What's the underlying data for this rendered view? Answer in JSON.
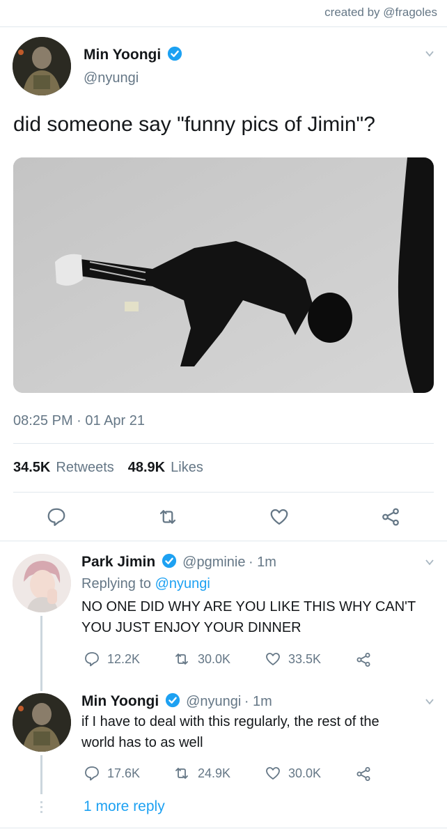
{
  "credit": "created by @fragoles",
  "main_tweet": {
    "name": "Min Yoongi",
    "handle": "@nyungi",
    "text": "did someone say \"funny pics of Jimin\"?",
    "timestamp": "08:25 PM · 01 Apr 21",
    "retweets_count": "34.5K",
    "retweets_label": "Retweets",
    "likes_count": "48.9K",
    "likes_label": "Likes"
  },
  "replies": [
    {
      "name": "Park Jimin",
      "handle": "@pgminie",
      "time": "· 1m",
      "replying_label": "Replying to",
      "replying_handle": "@nyungi",
      "text_line1": "NO ONE DID WHY ARE YOU LIKE THIS WHY CAN'T",
      "text_line2": "YOU JUST ENJOY YOUR DINNER",
      "comments": "12.2K",
      "retweets": "30.0K",
      "likes": "33.5K"
    },
    {
      "name": "Min Yoongi",
      "handle": "@nyungi",
      "time": "· 1m",
      "text_line1": "if I have to deal with this regularly, the rest of the",
      "text_line2": "world has to as well",
      "comments": "17.6K",
      "retweets": "24.9K",
      "likes": "30.0K"
    }
  ],
  "more_replies": "1 more reply",
  "colors": {
    "accent": "#1da1f2",
    "muted": "#657786",
    "text": "#14171a",
    "divider": "#e1e8ed"
  }
}
